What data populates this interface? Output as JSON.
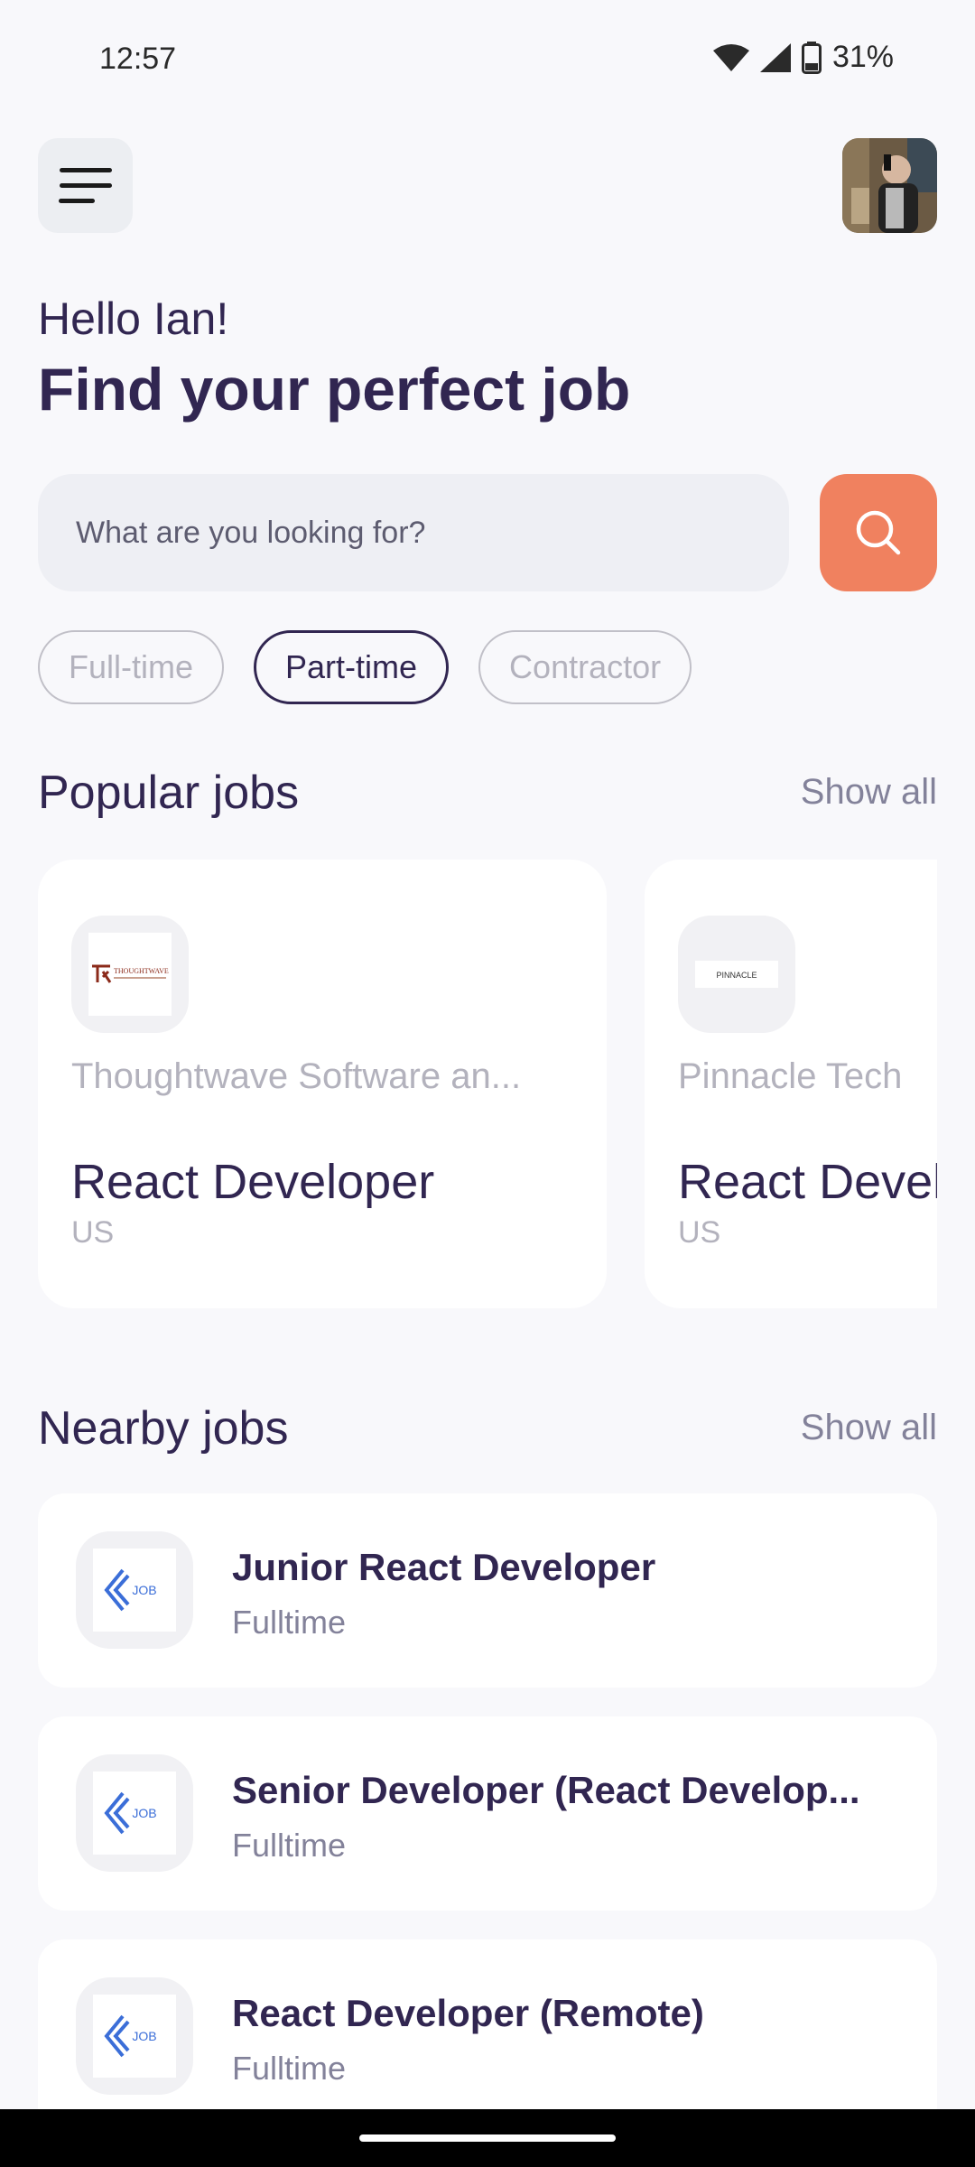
{
  "status_bar": {
    "time": "12:57",
    "battery": "31%"
  },
  "header": {
    "menu_icon": "hamburger-menu-icon",
    "avatar": "profile-avatar"
  },
  "welcome": {
    "greeting": "Hello Ian!",
    "headline": "Find your perfect job"
  },
  "search": {
    "placeholder": "What are you looking for?",
    "icon": "search-icon"
  },
  "job_types": [
    {
      "label": "Full-time",
      "active": false
    },
    {
      "label": "Part-time",
      "active": true
    },
    {
      "label": "Contractor",
      "active": false
    }
  ],
  "popular": {
    "title": "Popular jobs",
    "show_all": "Show all",
    "cards": [
      {
        "logo_text": "THOUGHTWAVE",
        "company": "Thoughtwave Software an...",
        "job_title": "React Developer",
        "location": "US"
      },
      {
        "logo_text": "PINNACLE",
        "company": "Pinnacle Tech",
        "job_title": "React Developer",
        "location": "US"
      }
    ]
  },
  "nearby": {
    "title": "Nearby jobs",
    "show_all": "Show all",
    "jobs": [
      {
        "title": "Junior React Developer",
        "type": "Fulltime",
        "logo_text": "JOB"
      },
      {
        "title": "Senior Developer (React Develop...",
        "type": "Fulltime",
        "logo_text": "JOB"
      },
      {
        "title": "React Developer (Remote)",
        "type": "Fulltime",
        "logo_text": "JOB"
      }
    ]
  },
  "colors": {
    "accent": "#f0815f",
    "primary": "#312651",
    "background": "#f8f8fb",
    "muted": "#b3b2bd"
  }
}
